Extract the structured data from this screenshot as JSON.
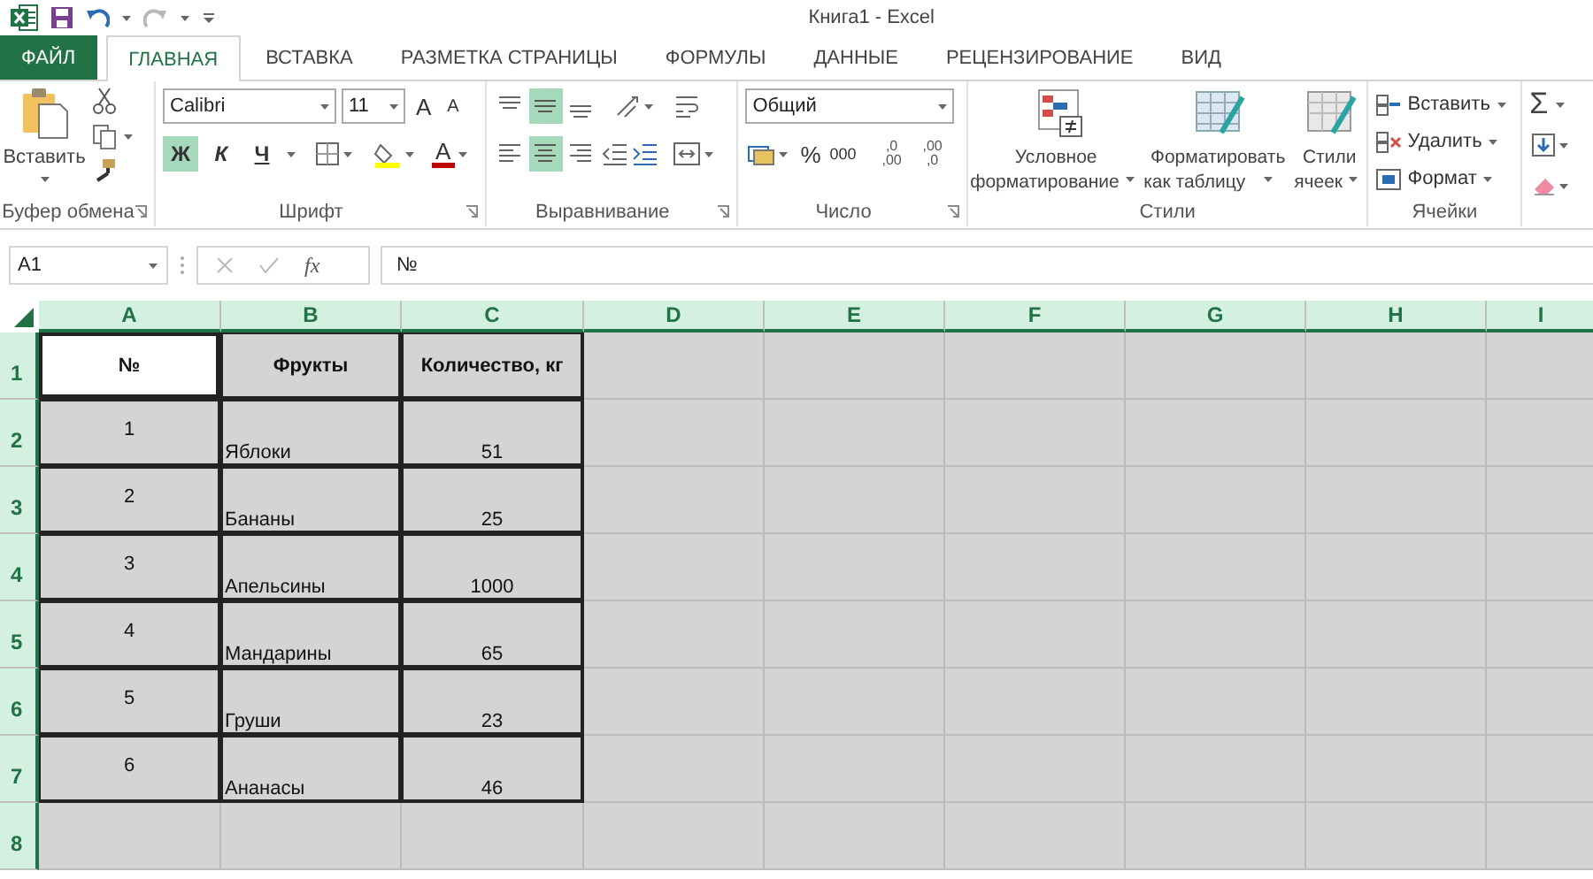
{
  "window": {
    "title": "Книга1 - Excel"
  },
  "quick_access": {
    "undo_enabled": true,
    "redo_enabled": false
  },
  "tabs": [
    {
      "label": "ФАЙЛ",
      "kind": "file",
      "selected": false
    },
    {
      "label": "ГЛАВНАЯ",
      "kind": "tab",
      "selected": true
    },
    {
      "label": "ВСТАВКА",
      "kind": "tab",
      "selected": false
    },
    {
      "label": "РАЗМЕТКА СТРАНИЦЫ",
      "kind": "tab",
      "selected": false
    },
    {
      "label": "ФОРМУЛЫ",
      "kind": "tab",
      "selected": false
    },
    {
      "label": "ДАННЫЕ",
      "kind": "tab",
      "selected": false
    },
    {
      "label": "РЕЦЕНЗИРОВАНИЕ",
      "kind": "tab",
      "selected": false
    },
    {
      "label": "ВИД",
      "kind": "tab",
      "selected": false
    }
  ],
  "ribbon": {
    "clipboard": {
      "paste_label": "Вставить",
      "group_label": "Буфер обмена"
    },
    "font": {
      "name": "Calibri",
      "size": "11",
      "grow_label": "A",
      "shrink_label": "A",
      "font_color_label": "A",
      "group_label": "Шрифт",
      "format_buttons": [
        {
          "label": "Ж",
          "kind": "bold",
          "selected": true
        },
        {
          "label": "К",
          "kind": "italic",
          "selected": false
        },
        {
          "label": "Ч",
          "kind": "underline",
          "selected": false
        }
      ]
    },
    "alignment": {
      "group_label": "Выравнивание",
      "buttons": [
        {
          "kind": "top",
          "selected": false
        },
        {
          "kind": "middle",
          "selected": true
        },
        {
          "kind": "bottom",
          "selected": false
        },
        {
          "kind": "left",
          "selected": false
        },
        {
          "kind": "center",
          "selected": true
        },
        {
          "kind": "right",
          "selected": false
        }
      ]
    },
    "number": {
      "format": "Общий",
      "percent": "%",
      "thousands": "000",
      "group_label": "Число",
      "decimal_buttons": [
        {
          "top": ",0",
          "bottom": ",00"
        },
        {
          "top": ",00",
          "bottom": ",0"
        }
      ]
    },
    "styles": {
      "group_label": "Стили",
      "buttons": [
        {
          "kind": "conditional",
          "label": "Условное форматирование"
        },
        {
          "kind": "table",
          "label": "Форматировать как таблицу"
        },
        {
          "kind": "cell",
          "label": "Стили ячеек"
        }
      ]
    },
    "cells": {
      "group_label": "Ячейки",
      "buttons": [
        {
          "kind": "insert",
          "label": "Вставить"
        },
        {
          "kind": "delete",
          "label": "Удалить"
        },
        {
          "kind": "format",
          "label": "Формат"
        }
      ]
    },
    "editing": {
      "sum": "Σ"
    }
  },
  "formula_bar": {
    "name_box": "A1",
    "function_label": "fx",
    "formula": "№"
  },
  "sheet": {
    "columns": [
      {
        "header": "A",
        "selected": true
      },
      {
        "header": "B",
        "selected": true
      },
      {
        "header": "C",
        "selected": true
      },
      {
        "header": "D",
        "selected": true
      },
      {
        "header": "E",
        "selected": true
      },
      {
        "header": "F",
        "selected": true
      },
      {
        "header": "G",
        "selected": true
      },
      {
        "header": "H",
        "selected": true
      },
      {
        "header": "I",
        "selected": true
      }
    ],
    "rows": [
      {
        "header": "1",
        "selected": true,
        "cells": [
          {
            "text": "№",
            "active": true
          },
          {
            "text": "Фрукты",
            "active": false
          },
          {
            "text": "Количество, кг",
            "active": false
          }
        ]
      },
      {
        "header": "2",
        "selected": true,
        "cells": [
          {
            "text": "1",
            "active": false
          },
          {
            "text": "Яблоки",
            "active": false
          },
          {
            "text": "51",
            "active": false
          }
        ]
      },
      {
        "header": "3",
        "selected": true,
        "cells": [
          {
            "text": "2",
            "active": false
          },
          {
            "text": "Бананы",
            "active": false
          },
          {
            "text": "25",
            "active": false
          }
        ]
      },
      {
        "header": "4",
        "selected": true,
        "cells": [
          {
            "text": "3",
            "active": false
          },
          {
            "text": "Апельсины",
            "active": false
          },
          {
            "text": "1000",
            "active": false
          }
        ]
      },
      {
        "header": "5",
        "selected": true,
        "cells": [
          {
            "text": "4",
            "active": false
          },
          {
            "text": "Мандарины",
            "active": false
          },
          {
            "text": "65",
            "active": false
          }
        ]
      },
      {
        "header": "6",
        "selected": true,
        "cells": [
          {
            "text": "5",
            "active": false
          },
          {
            "text": "Груши",
            "active": false
          },
          {
            "text": "23",
            "active": false
          }
        ]
      },
      {
        "header": "7",
        "selected": true,
        "cells": [
          {
            "text": "6",
            "active": false
          },
          {
            "text": "Ананасы",
            "active": false
          },
          {
            "text": "46",
            "active": false
          }
        ]
      },
      {
        "header": "8",
        "selected": true
      }
    ]
  }
}
